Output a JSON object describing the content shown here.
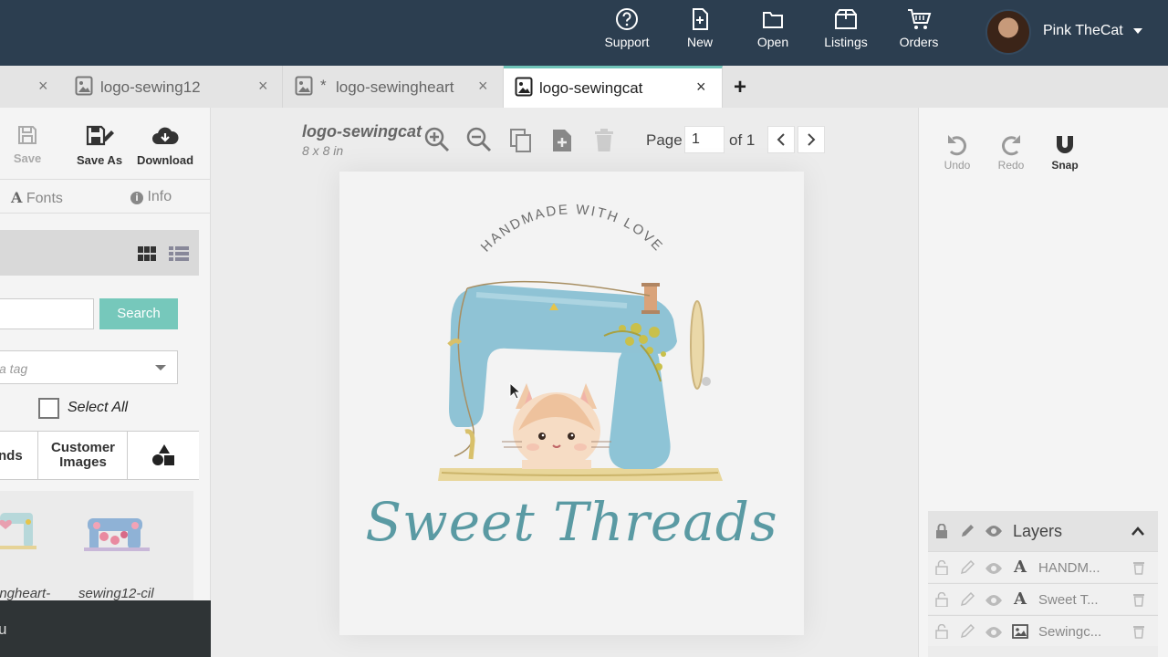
{
  "topnav": {
    "items": [
      {
        "label": "Support",
        "icon": "question-circle-icon"
      },
      {
        "label": "New",
        "icon": "new-file-icon"
      },
      {
        "label": "Open",
        "icon": "folder-icon"
      },
      {
        "label": "Listings",
        "icon": "box-icon"
      },
      {
        "label": "Orders",
        "icon": "cart-icon"
      }
    ],
    "user_name": "Pink TheCat"
  },
  "tabs": [
    {
      "label": "logo-sewing12",
      "dirty": false,
      "active": false
    },
    {
      "label": "logo-sewingheart",
      "dirty": true,
      "dirty_mark": "*",
      "active": false
    },
    {
      "label": "logo-sewingcat",
      "dirty": false,
      "active": true
    }
  ],
  "tab_add": "+",
  "tab_close": "×",
  "left": {
    "tools": {
      "save": "Save",
      "save_as": "Save As",
      "download": "Download"
    },
    "subtabs": {
      "fonts": "Fonts",
      "info": "Info"
    },
    "search_button": "Search",
    "tag_placeholder": "a tag",
    "select_all": "Select All",
    "categories": {
      "partial": "nds",
      "customer_images": "Customer Images"
    },
    "thumbnails": [
      {
        "label": "ingheart-"
      },
      {
        "label": "sewing12-cil"
      }
    ],
    "footer_text": "u"
  },
  "canvas": {
    "doc_title": "logo-sewingcat",
    "doc_size": "8 x 8 in",
    "page_label": "Page",
    "page_value": "1",
    "page_of": "of 1"
  },
  "artwork": {
    "arc_text": "HANDMADE WITH LOVE",
    "brand_text": "Sweet Threads"
  },
  "right": {
    "undo": "Undo",
    "redo": "Redo",
    "snap": "Snap",
    "layers_title": "Layers",
    "layers": [
      {
        "name": "HANDM...",
        "type": "text"
      },
      {
        "name": "Sweet T...",
        "type": "text"
      },
      {
        "name": "Sewingc...",
        "type": "image"
      }
    ]
  },
  "colors": {
    "topbar": "#2c3e50",
    "accent": "#76c8bb",
    "brand_text": "#5a9aa3"
  }
}
